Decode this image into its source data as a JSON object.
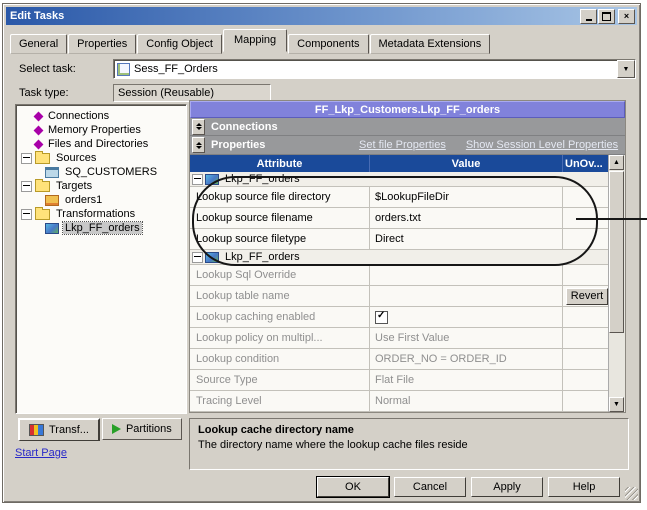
{
  "window": {
    "title": "Edit Tasks",
    "controls": {
      "minimize": "_",
      "maximize": "□",
      "close": "×"
    }
  },
  "icons": {
    "dropdown": "▼",
    "up_arrow": "▲",
    "down_arrow": "▼"
  },
  "tabs": [
    {
      "label": "General",
      "active": false
    },
    {
      "label": "Properties",
      "active": false
    },
    {
      "label": "Config Object",
      "active": false
    },
    {
      "label": "Mapping",
      "active": true
    },
    {
      "label": "Components",
      "active": false
    },
    {
      "label": "Metadata Extensions",
      "active": false
    }
  ],
  "form": {
    "select_task_label": "Select task:",
    "select_task_value": "Sess_FF_Orders",
    "task_type_label": "Task type:",
    "task_type_value": "Session (Reusable)"
  },
  "tree": {
    "items": [
      {
        "label": "Connections",
        "icon": "diamond",
        "indent": 1
      },
      {
        "label": "Memory Properties",
        "icon": "diamond",
        "indent": 1
      },
      {
        "label": "Files and Directories",
        "icon": "diamond",
        "indent": 1
      },
      {
        "label": "Sources",
        "icon": "folder",
        "indent": 0,
        "expander": true
      },
      {
        "label": "SQ_CUSTOMERS",
        "icon": "source",
        "indent": 2
      },
      {
        "label": "Targets",
        "icon": "folder",
        "indent": 0,
        "expander": true
      },
      {
        "label": "orders1",
        "icon": "target",
        "indent": 2
      },
      {
        "label": "Transformations",
        "icon": "folder",
        "indent": 0,
        "expander": true
      },
      {
        "label": "Lkp_FF_orders",
        "icon": "transformation",
        "indent": 2,
        "selected": true
      }
    ]
  },
  "panel": {
    "header": "FF_Lkp_Customers.Lkp_FF_orders",
    "bands": [
      {
        "label": "Connections"
      },
      {
        "label": "Properties",
        "links": [
          "Set file Properties",
          "Show Session Level Properties"
        ]
      }
    ]
  },
  "grid": {
    "columns": [
      "Attribute",
      "Value",
      "UnOv..."
    ],
    "rows": [
      {
        "type": "group",
        "label": "Lkp_FF_orders",
        "disabled": false
      },
      {
        "type": "data",
        "attribute": "Lookup source file directory",
        "value": "$LookupFileDir",
        "disabled": false
      },
      {
        "type": "data",
        "attribute": "Lookup source filename",
        "value": "orders.txt",
        "disabled": false
      },
      {
        "type": "data",
        "attribute": "Lookup source filetype",
        "value": "Direct",
        "disabled": false
      },
      {
        "type": "group",
        "label": "Lkp_FF_orders",
        "disabled": false
      },
      {
        "type": "data",
        "attribute": "Lookup Sql Override",
        "value": "",
        "disabled": true
      },
      {
        "type": "data",
        "attribute": "Lookup table name",
        "value": "",
        "disabled": true,
        "control": "revert",
        "control_label": "Revert"
      },
      {
        "type": "data",
        "attribute": "Lookup caching enabled",
        "value": "",
        "disabled": true,
        "control": "checkbox",
        "checked": true
      },
      {
        "type": "data",
        "attribute": "Lookup policy on multipl...",
        "value": "Use First Value",
        "disabled": true
      },
      {
        "type": "data",
        "attribute": "Lookup condition",
        "value": "ORDER_NO = ORDER_ID",
        "disabled": true
      },
      {
        "type": "data",
        "attribute": "Source Type",
        "value": "Flat File",
        "disabled": true
      },
      {
        "type": "data",
        "attribute": "Tracing Level",
        "value": "Normal",
        "disabled": true
      }
    ]
  },
  "footer_tabs": [
    {
      "label": "Transf...",
      "icon": "transform-grid"
    },
    {
      "label": "Partitions",
      "icon": "partition-arrow"
    }
  ],
  "start_page": "Start Page",
  "description": {
    "title": "Lookup cache directory name",
    "text": "The directory name where the lookup cache files reside"
  },
  "buttons": [
    "OK",
    "Cancel",
    "Apply",
    "Help"
  ],
  "colors": {
    "dialog_bg": "#d4d0c8",
    "titlebar_start": "#2a58a8",
    "titlebar_end": "#a9c6e6",
    "panel_header_bg": "#8182db",
    "grid_header_bg": "#1a4a9a",
    "band_bg": "#98999b",
    "disabled_text": "#8f8f8f",
    "link_blue": "#2929c8",
    "callout": "#161616"
  }
}
